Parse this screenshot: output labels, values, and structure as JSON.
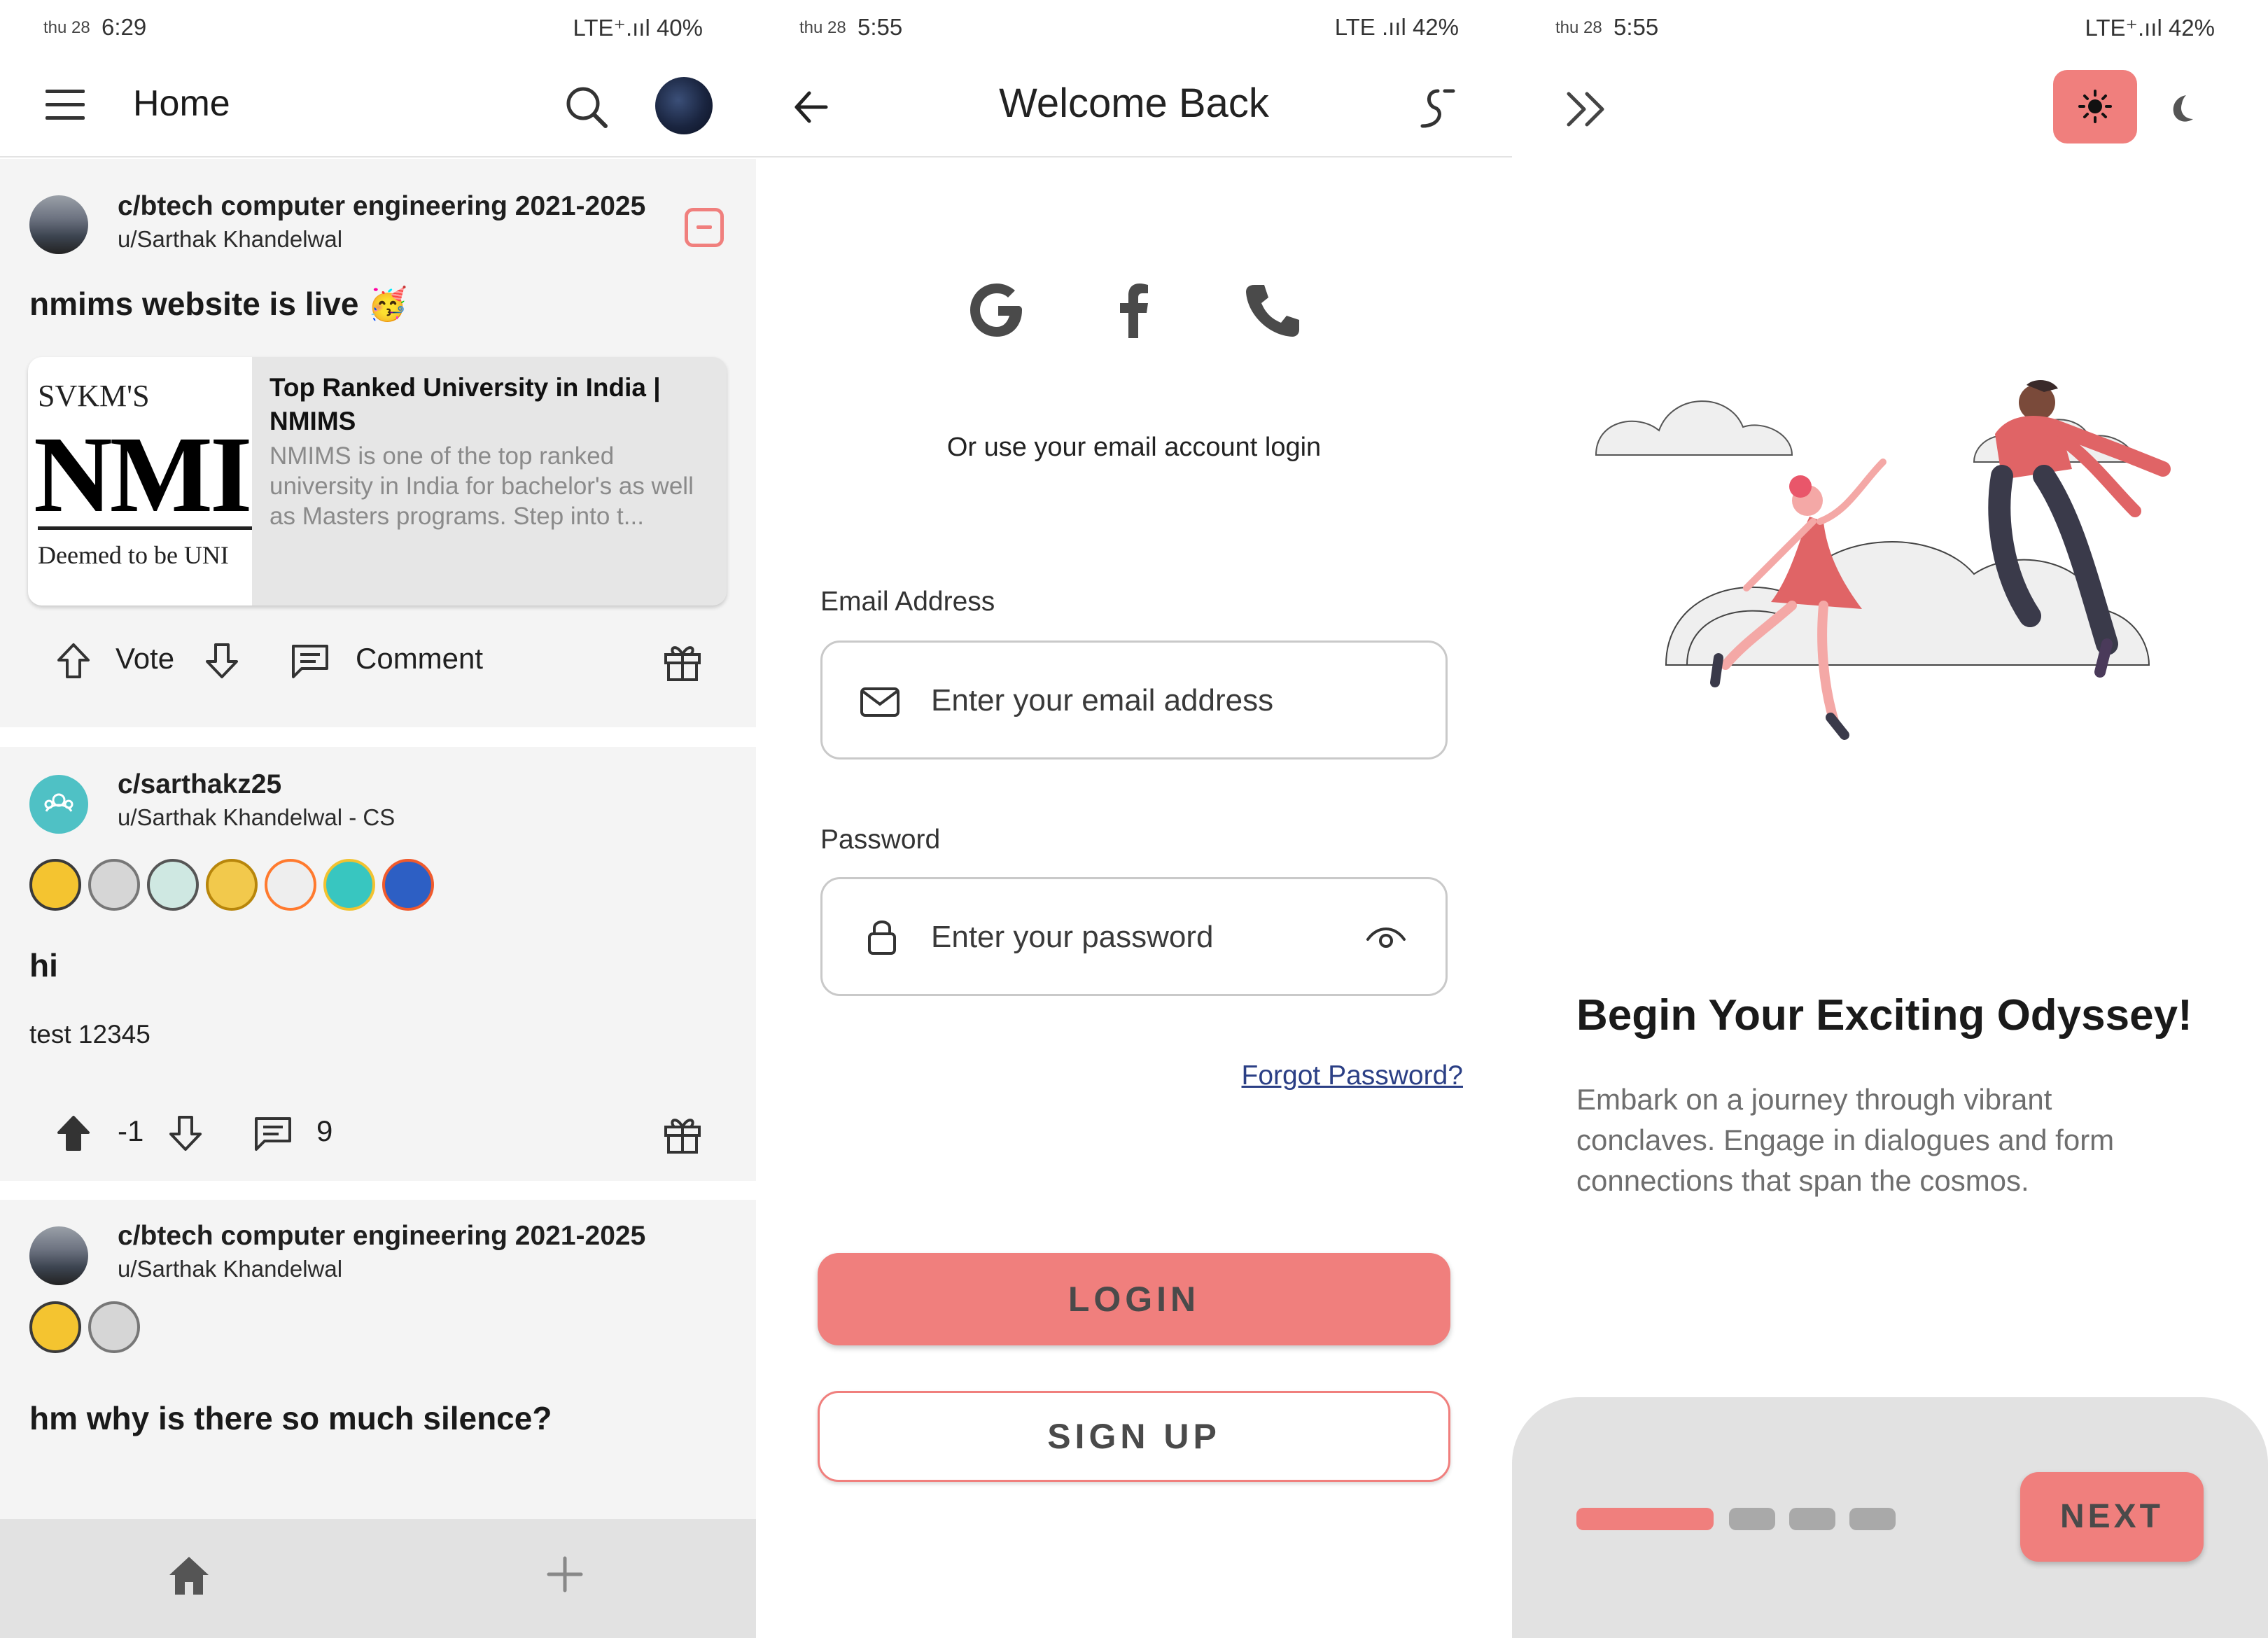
{
  "home": {
    "status": {
      "day": "thu 28",
      "time": "6:29",
      "network": "LTE⁺.ııl 40%"
    },
    "header": {
      "title": "Home"
    },
    "posts": [
      {
        "community": "c/btech computer engineering 2021-2025",
        "user": "u/Sarthak Khandelwal",
        "title": "nmims website is live 🥳",
        "link_card": {
          "thumb_top": "SVKM'S",
          "thumb_logo": "NMI",
          "thumb_bottom": "Deemed to be UNI",
          "title": "Top Ranked University in India | NMIMS",
          "description": "NMIMS is one of the top ranked university in India for bachelor's as well as Masters programs. Step into t..."
        },
        "vote_label": "Vote",
        "comment_label": "Comment"
      },
      {
        "community": "c/sarthakz25",
        "user": "u/Sarthak Khandelwal - CS",
        "title": "hi",
        "body": "test 12345",
        "score": "-1",
        "comment_count": "9"
      },
      {
        "community": "c/btech computer engineering 2021-2025",
        "user": "u/Sarthak Khandelwal",
        "title": "hm why is there so much silence?"
      }
    ]
  },
  "login": {
    "status": {
      "day": "thu 28",
      "time": "5:55",
      "network": "LTE .ııl 42%"
    },
    "header": {
      "title": "Welcome Back"
    },
    "or_text": "Or use your email account login",
    "email": {
      "label": "Email Address",
      "placeholder": "Enter your email address"
    },
    "password": {
      "label": "Password",
      "placeholder": "Enter your password"
    },
    "forgot": "Forgot Password?",
    "login_button": "LOGIN",
    "signup_button": "SIGN UP"
  },
  "onboarding": {
    "status": {
      "day": "thu 28",
      "time": "5:55",
      "network": "LTE⁺.ııl 42%"
    },
    "title": "Begin Your Exciting Odyssey!",
    "description": "Embark on a journey through vibrant conclaves. Engage in dialogues and form connections that span the cosmos.",
    "next_button": "NEXT",
    "pagination": {
      "total": 4,
      "current": 1
    }
  },
  "colors": {
    "accent": "#f07f7d",
    "card_bg": "#f4f4f4",
    "nav_bg": "#e2e2e2"
  }
}
